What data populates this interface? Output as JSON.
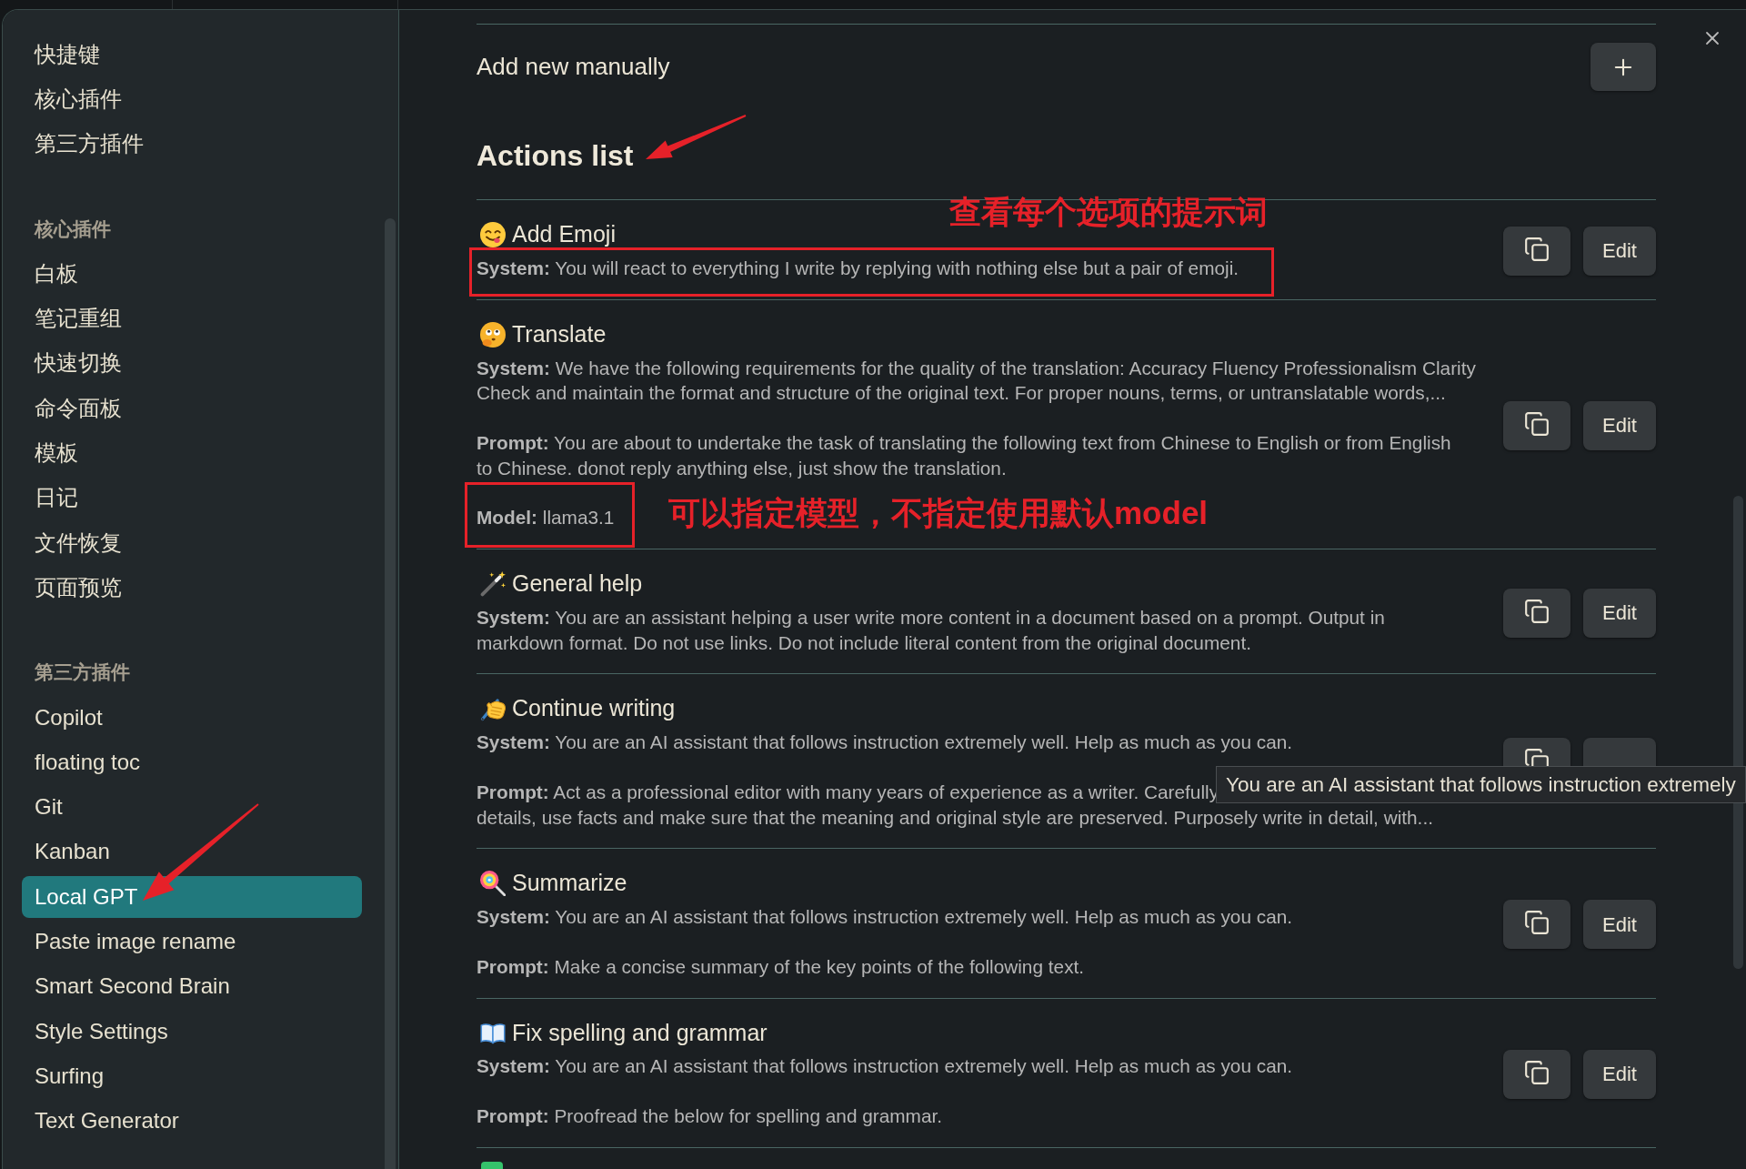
{
  "sidebar": {
    "groups": [
      {
        "items": [
          {
            "label": "快捷键",
            "selected": false
          },
          {
            "label": "核心插件",
            "selected": false
          },
          {
            "label": "第三方插件",
            "selected": false
          }
        ]
      },
      {
        "heading": "核心插件",
        "items": [
          {
            "label": "白板",
            "selected": false
          },
          {
            "label": "笔记重组",
            "selected": false
          },
          {
            "label": "快速切换",
            "selected": false
          },
          {
            "label": "命令面板",
            "selected": false
          },
          {
            "label": "模板",
            "selected": false
          },
          {
            "label": "日记",
            "selected": false
          },
          {
            "label": "文件恢复",
            "selected": false
          },
          {
            "label": "页面预览",
            "selected": false
          }
        ]
      },
      {
        "heading": "第三方插件",
        "items": [
          {
            "label": "Copilot",
            "selected": false
          },
          {
            "label": "floating toc",
            "selected": false
          },
          {
            "label": "Git",
            "selected": false
          },
          {
            "label": "Kanban",
            "selected": false
          },
          {
            "label": "Local GPT",
            "selected": true
          },
          {
            "label": "Paste image rename",
            "selected": false
          },
          {
            "label": "Smart Second Brain",
            "selected": false
          },
          {
            "label": "Style Settings",
            "selected": false
          },
          {
            "label": "Surfing",
            "selected": false
          },
          {
            "label": "Text Generator",
            "selected": false
          }
        ]
      }
    ]
  },
  "add_new": {
    "label": "Add new manually"
  },
  "actions_heading": "Actions list",
  "actions": [
    {
      "title": "Add Emoji",
      "paragraphs": [
        {
          "lines": [
            "**System:** You will react to everything I write by replying with nothing else but a pair of emoji."
          ]
        }
      ],
      "edit_label": "Edit"
    },
    {
      "title": "Translate",
      "paragraphs": [
        {
          "lines": [
            "**System:** We have the following requirements for the quality of the translation: Accuracy Fluency Professionalism Clarity",
            "Check and maintain the format and structure of the original text. For proper nouns, terms, or untranslatable words,..."
          ]
        },
        {
          "lines": [
            "**Prompt:** You are about to undertake the task of translating the following text from Chinese to English or from English",
            "to Chinese. donot reply anything else, just show the translation."
          ]
        },
        {
          "lines": [
            "**Model:** llama3.1"
          ]
        }
      ],
      "edit_label": "Edit"
    },
    {
      "title": "General help",
      "paragraphs": [
        {
          "lines": [
            "**System:** You are an assistant helping a user write more content in a document based on a prompt. Output in",
            "markdown format. Do not use links. Do not include literal content from the original document."
          ]
        }
      ],
      "edit_label": "Edit"
    },
    {
      "title": "Continue writing",
      "paragraphs": [
        {
          "lines": [
            "**System:** You are an AI assistant that follows instruction extremely well. Help as much as you can."
          ]
        },
        {
          "parts": [
            "**Prompt:** Act as a professional editor with many years of experience as a writer. Carefully",
            "details, use facts and make sure that the meaning and original style are preserved. Purposely write in detail, with..."
          ]
        }
      ]
    },
    {
      "title": "Summarize",
      "paragraphs": [
        {
          "lines": [
            "**System:** You are an AI assistant that follows instruction extremely well. Help as much as you can."
          ]
        },
        {
          "lines": [
            "**Prompt:** Make a concise summary of the key points of the following text."
          ]
        }
      ],
      "edit_label": "Edit"
    },
    {
      "title": "Fix spelling and grammar",
      "paragraphs": [
        {
          "lines": [
            "**System:** You are an AI assistant that follows instruction extremely well. Help as much as you can."
          ]
        },
        {
          "lines": [
            "**Prompt:** Proofread the below for spelling and grammar."
          ]
        }
      ],
      "edit_label": "Edit"
    }
  ],
  "tooltip": {
    "text": "You are an AI assistant that follows instruction extremely"
  },
  "annotations": [
    {
      "text": "查看每个选项的提示词"
    },
    {
      "text": "可以指定模型，不指定使用默认model"
    }
  ]
}
